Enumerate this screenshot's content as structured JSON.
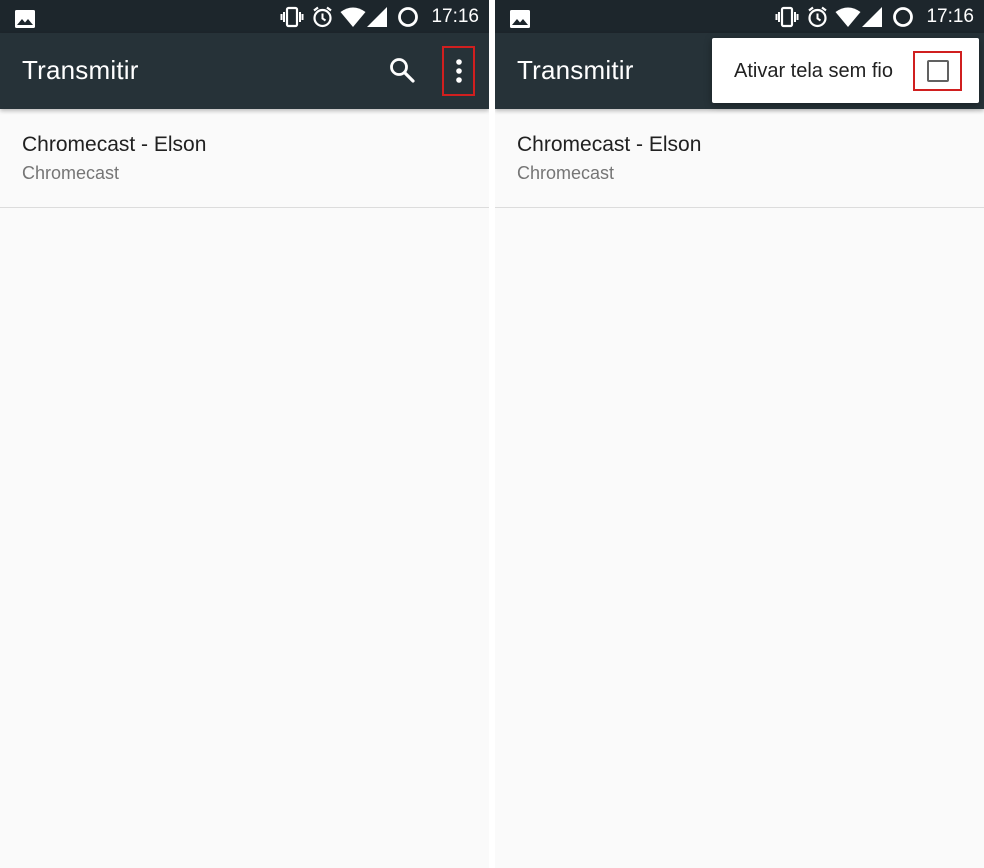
{
  "status_bar": {
    "time": "17:16",
    "icons": [
      "gallery-icon",
      "vibrate-icon",
      "alarm-icon",
      "wifi-icon",
      "signal-icon",
      "battery-icon"
    ]
  },
  "screens": [
    {
      "toolbar": {
        "title": "Transmitir",
        "search_icon": "search-icon",
        "overflow_icon": "more-vert-icon"
      },
      "device": {
        "name": "Chromecast - Elson",
        "type": "Chromecast"
      }
    },
    {
      "toolbar": {
        "title": "Transmitir"
      },
      "device": {
        "name": "Chromecast - Elson",
        "type": "Chromecast"
      },
      "menu": {
        "item_label": "Ativar tela sem fio",
        "checked": false
      }
    }
  ],
  "colors": {
    "status_bar": "#1d262c",
    "toolbar": "#263238",
    "background": "#fafafa",
    "highlight_box": "#d01f1f"
  }
}
